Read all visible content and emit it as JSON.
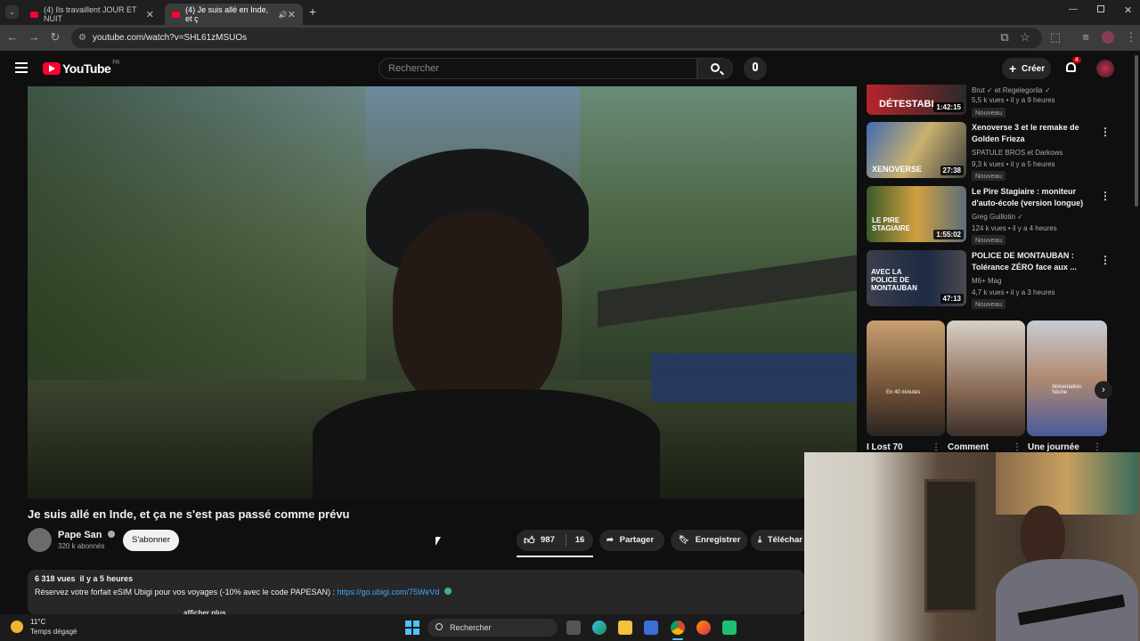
{
  "browser": {
    "tabs": [
      {
        "label": "(4) Ils travaillent JOUR ET NUIT"
      },
      {
        "label": "(4) Je suis allé en Inde, et ç"
      }
    ],
    "url": "youtube.com/watch?v=SHL61zMSUOs"
  },
  "header": {
    "logo_text": "YouTube",
    "region": "FR",
    "search_placeholder": "Rechercher",
    "create_label": "Créer",
    "notif_count": "4"
  },
  "sidebar": {
    "recommendations": [
      {
        "meta1": "Brut ✓ et Regelegorila ✓",
        "meta2": "5,5 k vues • il y a 9 heures",
        "badge": "Nouveau",
        "thumb_text": "DÉTESTABI",
        "duration": "1:42:15"
      },
      {
        "title": "Xenoverse 3 et le remake de Golden Frieza",
        "meta1": "SPATULE BROS et Darkows",
        "meta2": "9,3 k vues • il y a 5 heures",
        "badge": "Nouveau",
        "thumb_text": "XENOVERSE",
        "duration": "27:38"
      },
      {
        "title": "Le Pire Stagiaire : moniteur d'auto-école (version longue)",
        "meta1": "Greg Guillotin ✓",
        "meta2": "124 k vues • il y a 4 heures",
        "badge": "Nouveau",
        "thumb_text": "LE PIRE STAGIAIRE",
        "duration": "1:55:02"
      },
      {
        "title": "POLICE DE MONTAUBAN : Tolérance ZÉRO face aux ...",
        "meta1": "M6+ Mag",
        "meta2": "4,7 k vues • il y a 3 heures",
        "badge": "Nouveau",
        "thumb_text": "AVEC LA POLICE DE MONTAUBAN",
        "duration": "47:13"
      }
    ],
    "shorts": [
      {
        "title": "I Lost 70",
        "overlay": "En 40 minutes"
      },
      {
        "title": "Comment",
        "overlay": ""
      },
      {
        "title": "Une journée",
        "overlay": "Alimentation Sèche"
      }
    ]
  },
  "video": {
    "title": "Je suis allé en Inde, et ça ne s'est pas passé comme prévu",
    "channel": "Pape San",
    "subscribers": "320 k abonnés",
    "subscribe_label": "S'abonner",
    "likes": "987",
    "dislikes": "16",
    "share_label": "Partager",
    "save_label": "Enregistrer",
    "download_label": "Téléchar"
  },
  "description": {
    "stats": "6 318 vues  il y a 5 heures",
    "line1_text": "Réservez votre forfait eSIM Ubigi pour vos voyages (-10% avec le code PAPESAN) : ",
    "line1_link": "https://go.ubigi.com/75WeVd",
    "partial": "afficher plus"
  },
  "taskbar": {
    "weather_temp": "11°C",
    "weather_desc": "Temps dégagé",
    "search_label": "Rechercher"
  },
  "colors": {
    "yt_red": "#ff0033",
    "link_blue": "#3ea6ff",
    "badge_red": "#cc0000"
  }
}
